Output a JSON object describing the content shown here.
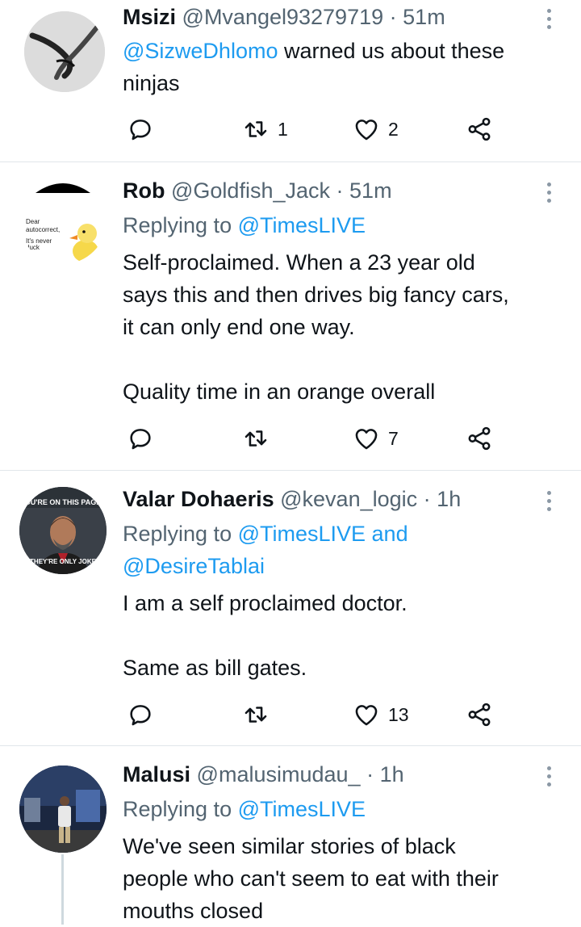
{
  "tweets": [
    {
      "name": "Msizi",
      "handle": "@Mvangel93279719",
      "sep": "·",
      "time": "51m",
      "body_mention": "@SizweDhlomo",
      "body_rest": " warned us about these",
      "body_line2": "ninjas",
      "retweets": "1",
      "likes": "2"
    },
    {
      "name": "Rob",
      "handle": "@Goldfish_Jack",
      "sep": "·",
      "time": "51m",
      "replying_prefix": "Replying to ",
      "replying_to": "@TimesLIVE",
      "body_lines": [
        "Self-proclaimed. When a 23 year old",
        "says this and then drives big fancy cars,",
        "it can only end  one way."
      ],
      "body_line_extra": "Quality time in an orange overall",
      "avatar_text": {
        "l1": "Dear",
        "l2": "autocorrect,",
        "l3": "It's never",
        "l4": "duck"
      },
      "retweets": "",
      "likes": "7"
    },
    {
      "name": "Valar Dohaeris",
      "handle": "@kevan_logic",
      "sep": "·",
      "time": "1h",
      "replying_prefix": "Replying to ",
      "replying_to": "@TimesLIVE and",
      "replying_to2": "@DesireTablai",
      "body_line1": "I am a self proclaimed doctor.",
      "body_line2": "Same as bill gates.",
      "avatar_text": {
        "top": "OU'RE ON THIS PAGE",
        "bottom": "THEY'RE ONLY JOKE"
      },
      "retweets": "",
      "likes": "13"
    },
    {
      "name": "Malusi",
      "handle": "@malusimudau_",
      "sep": "·",
      "time": "1h",
      "replying_prefix": "Replying to ",
      "replying_to": "@TimesLIVE",
      "body_lines": [
        "We've seen similar stories of black",
        "people who can't seem to eat with their",
        "mouths closed"
      ]
    }
  ],
  "icons": {
    "reply": "reply-icon",
    "retweet": "retweet-icon",
    "like": "heart-icon",
    "share": "share-icon",
    "more": "more-options-icon"
  },
  "colors": {
    "link": "#1d9bf0",
    "secondary": "#536471",
    "text": "#0f1419",
    "divider": "#e1e6ea"
  }
}
